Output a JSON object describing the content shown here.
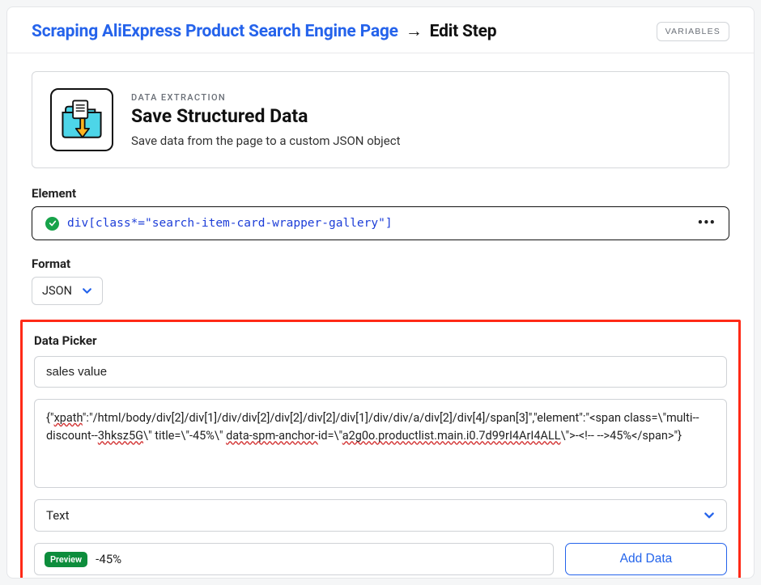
{
  "header": {
    "breadcrumb_link": "Scraping AliExpress Product Search Engine Page",
    "breadcrumb_arrow": "→",
    "breadcrumb_current": "Edit Step",
    "variables_button": "VARIABLES"
  },
  "step": {
    "category": "DATA EXTRACTION",
    "title": "Save Structured Data",
    "description": "Save data from the page to a custom JSON object"
  },
  "element": {
    "label": "Element",
    "selector": "div[class*=\"search-item-card-wrapper-gallery\"]"
  },
  "format": {
    "label": "Format",
    "value": "JSON"
  },
  "dataPicker": {
    "label": "Data Picker",
    "name_value": "sales value",
    "json_leading": "{\"",
    "json_w1": "xpath",
    "json_mid1": "\":\"/html/body/div[2]/div[1]/div/div[2]/div[2]/div[2]/div[1]/div/div/a/div[2]/div[4]/span[3]\",\"element\":\"<span class=\\\"multi--discount--",
    "json_w2": "3hksz5G",
    "json_mid2": "\\\" title=\\\"-45%\\\" ",
    "json_w3": "data-spm-anchor-",
    "json_mid3": "id=\\\"",
    "json_w4": "a2g0o.productlist.main.i0.7d99rI4ArI4ALL",
    "json_tail": "\\\">-<!-- -->45%</span>\"}",
    "extract_type": "Text",
    "preview_badge": "Preview",
    "preview_value": "-45%",
    "add_data_button": "Add Data"
  }
}
